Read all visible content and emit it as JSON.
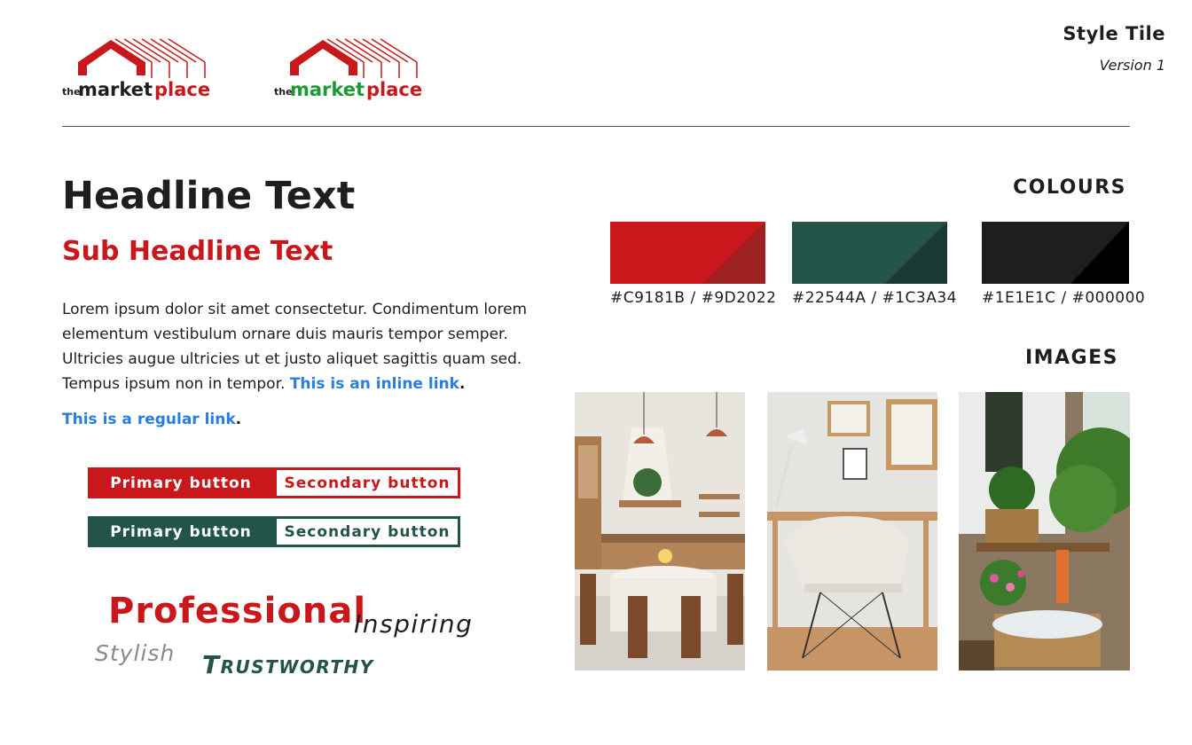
{
  "logos": [
    {
      "pre": "the",
      "word1": "market",
      "word2": "place",
      "word1_color": "#1e1e1c",
      "word2_color": "#c9181b"
    },
    {
      "pre": "the",
      "word1": "market",
      "word2": "place",
      "word1_color": "#1b9a35",
      "word2_color": "#c9181b"
    }
  ],
  "header": {
    "title": "Style Tile",
    "version": "Version 1"
  },
  "typography": {
    "headline": "Headline Text",
    "subheadline": "Sub Headline Text",
    "body": "Lorem ipsum dolor sit amet consectetur. Condimentum lorem elementum vestibulum ornare duis mauris tempor semper. Ultricies augue ultricies ut et justo aliquet sagittis quam sed. Tempus ipsum non in tempor.",
    "inline_link": "This is an inline link",
    "regular_link": "This is a regular link",
    "period": "."
  },
  "buttons": {
    "red": {
      "primary": "Primary button",
      "secondary": "Secondary button"
    },
    "green": {
      "primary": "Primary button",
      "secondary": "Secondary button"
    }
  },
  "keywords": {
    "professional": "Professional",
    "inspiring": "Inspiring",
    "stylish": "Stylish",
    "trustworthy": "Trustworthy"
  },
  "colours": {
    "title": "COLOURS",
    "swatches": [
      {
        "main": "#C9181B",
        "shade": "#9D2022",
        "label": "#C9181B / #9D2022"
      },
      {
        "main": "#22544A",
        "shade": "#1C3A34",
        "label": "#22544A / #1C3A34"
      },
      {
        "main": "#1E1E1C",
        "shade": "#000000",
        "label": "#1E1E1C / #000000"
      }
    ]
  },
  "images": {
    "title": "IMAGES",
    "items": [
      {
        "icon": "kitchen-dining-photo"
      },
      {
        "icon": "desk-chair-photo"
      },
      {
        "icon": "garden-plants-photo"
      }
    ]
  }
}
